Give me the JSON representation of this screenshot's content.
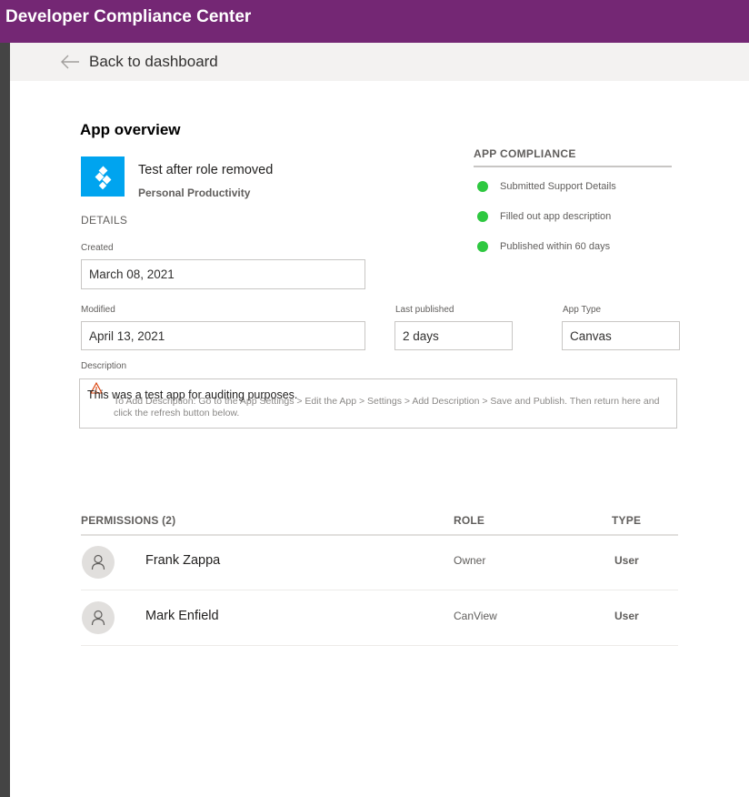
{
  "header": {
    "title": "Developer Compliance Center",
    "brand_color": "#742774"
  },
  "nav": {
    "back_label": "Back to dashboard",
    "back_icon": "arrow-left-icon"
  },
  "overview": {
    "title": "App overview",
    "app_name": "Test after role removed",
    "app_category": "Personal Productivity",
    "app_icon": "power-apps-icon",
    "app_icon_color": "#00a4ef"
  },
  "details": {
    "section_label": "DETAILS",
    "created_label": "Created",
    "created_value": "March 08, 2021",
    "modified_label": "Modified",
    "modified_value": "April 13, 2021",
    "last_published_label": "Last published",
    "last_published_value": "2 days",
    "app_type_label": "App Type",
    "app_type_value": "Canvas",
    "description_label": "Description",
    "description_value": "This was a test app for auditing purposes.",
    "description_hint": "To Add Description: Go to the App Settings > Edit the App > Settings > Add Description > Save and Publish. Then return here and  click the refresh button below.",
    "warning_icon": "warning-icon"
  },
  "compliance": {
    "title": "APP COMPLIANCE",
    "status_color": "#2ec840",
    "items": [
      {
        "label": "Submitted Support Details"
      },
      {
        "label": "Filled out app description"
      },
      {
        "label": "Published within 60 days"
      }
    ]
  },
  "permissions": {
    "header": "PERMISSIONS (2)",
    "role_header": "ROLE",
    "type_header": "TYPE",
    "rows": [
      {
        "name": "Frank Zappa",
        "role": "Owner",
        "type": "User"
      },
      {
        "name": "Mark Enfield",
        "role": "CanView",
        "type": "User"
      }
    ]
  }
}
